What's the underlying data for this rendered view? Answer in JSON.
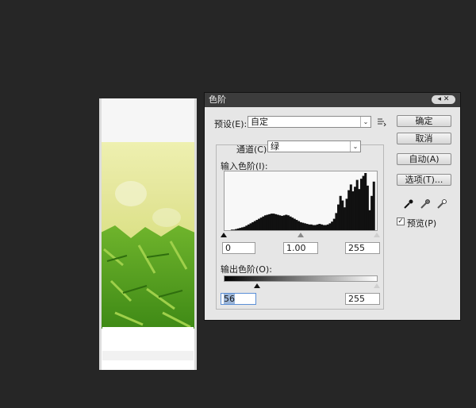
{
  "dialog": {
    "title": "色阶",
    "title_controls": "◂ ✕",
    "preset_label": "预设(E):",
    "preset_value": "自定",
    "preset_menu_icon": "list-options-icon",
    "channel_label": "通道(C):",
    "channel_value": "绿",
    "input_levels_label": "输入色阶(I):",
    "input_black": "0",
    "input_gamma": "1.00",
    "input_white": "255",
    "output_levels_label": "输出色阶(O):",
    "output_black": "56",
    "output_white": "255",
    "buttons": {
      "ok": "确定",
      "cancel": "取消",
      "auto": "自动(A)",
      "options": "选项(T)..."
    },
    "preview_label": "预览(P)",
    "preview_checked": "✓",
    "eyedroppers": [
      "black-eyedropper-icon",
      "gray-eyedropper-icon",
      "white-eyedropper-icon"
    ],
    "input_slider_levels": {
      "black": 0,
      "gamma": 1.0,
      "white": 255
    },
    "output_slider_levels": {
      "black": 56,
      "white": 255
    }
  },
  "histogram": {
    "channel": "绿",
    "counts": [
      0,
      0,
      0,
      1,
      1,
      2,
      3,
      4,
      5,
      6,
      8,
      10,
      12,
      14,
      16,
      18,
      20,
      22,
      24,
      26,
      27,
      28,
      29,
      29,
      28,
      27,
      26,
      25,
      26,
      27,
      26,
      24,
      22,
      20,
      18,
      16,
      14,
      13,
      12,
      11,
      10,
      10,
      9,
      9,
      10,
      11,
      10,
      9,
      9,
      10,
      12,
      15,
      20,
      30,
      45,
      60,
      52,
      40,
      55,
      70,
      80,
      68,
      76,
      88,
      72,
      90,
      95,
      100,
      78,
      35,
      60,
      85,
      0
    ]
  },
  "colors": {
    "dialog_bg": "#e6e6e6",
    "titlebar_bg": "#3c3c3c",
    "workspace_bg": "#262626",
    "focus_border": "#5b8fd6"
  }
}
